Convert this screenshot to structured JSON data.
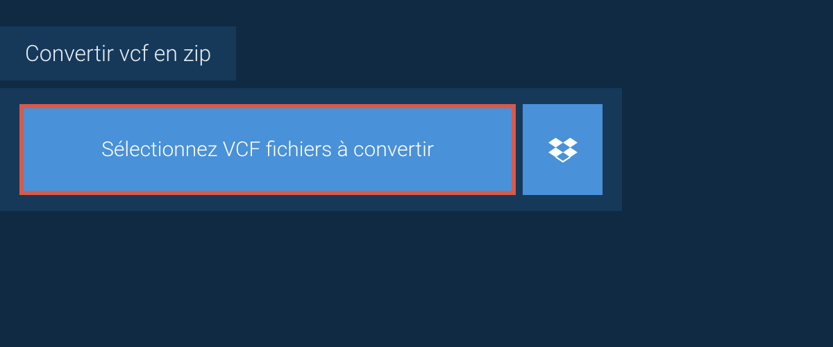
{
  "tab": {
    "label": "Convertir vcf en zip"
  },
  "buttons": {
    "select_files": "Sélectionnez VCF fichiers à convertir"
  },
  "colors": {
    "background": "#0f2a42",
    "panel": "#16395a",
    "button": "#4991d8",
    "highlight_border": "#d85a4a",
    "text": "#ffffff"
  }
}
